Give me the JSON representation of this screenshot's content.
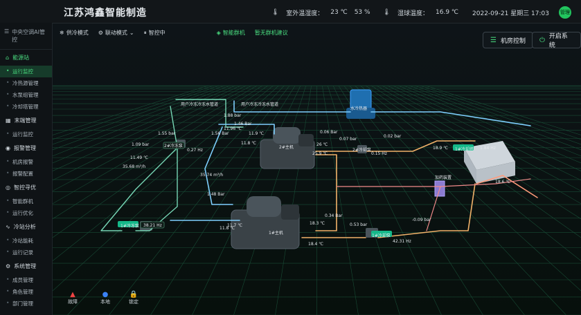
{
  "app": {
    "brand": "江苏鸿鑫智能制造"
  },
  "header": {
    "indoor_label": "室外温湿度：",
    "indoor_temp": "23 ℃",
    "indoor_humidity": "53 %",
    "outdoor_label": "湿球温度：",
    "outdoor_temp": "16.9 ℃",
    "datetime": "2022-09-21 星期三 17:03",
    "user_badge": "管理"
  },
  "sidebar": {
    "title": "中央空调AI管控",
    "groups": [
      {
        "label": "能源站",
        "items": [
          "运行监控",
          "冷热源管理",
          "水泵组管理",
          "冷却塔管理"
        ]
      },
      {
        "label": "末端管理",
        "items": [
          "运行监控"
        ]
      },
      {
        "label": "报警管理",
        "items": [
          "机房报警",
          "报警配置"
        ]
      },
      {
        "label": "智控寻优",
        "items": [
          "智能群机",
          "运行优化"
        ]
      },
      {
        "label": "冷站分析",
        "items": [
          "冷站能耗",
          "运行记录"
        ]
      },
      {
        "label": "系统管理",
        "items": [
          "成员管理",
          "角色管理",
          "部门管理"
        ]
      }
    ]
  },
  "toolbar": {
    "mode1": "供冷模式",
    "mode2": "联动模式",
    "mode3": "智控中",
    "smart": "智能群机",
    "suggest": "暂无群机建议"
  },
  "buttons": {
    "room_control": "机房控制",
    "start_system": "开启系统"
  },
  "diagram": {
    "user_supply": "用户冷冻冷冻水管道",
    "user_return": "用户冷冻冷冻水管道",
    "water_sep": "水冷热器",
    "chiller2": "2#主机",
    "chiller1": "1#主机",
    "pump2": "2#冷冻泵",
    "pump1": "1#冷冻泵",
    "cpump2": "2#冷却泵",
    "cpump1": "1#冷却泵",
    "tower": "1#冷却塔",
    "dosing": "加药装置",
    "v_1_88": "1.88 bar",
    "v_1_46": "1.46 Bar",
    "v_11_96": "11.96 ℃",
    "v_11_9": "11.9 ℃",
    "v_11_8a": "11.8 ℃",
    "v_1_55": "1.55 bar",
    "v_1_56": "1.56 Bar",
    "v_0_27": "0.27 Hz",
    "v_1_09": "1.09 bar",
    "v_11_49": "11.49 ℃",
    "v_35_68": "35.68 m³/h",
    "v_35_74": "35.74 m³/h",
    "v_0_06": "0.06 Bar",
    "v_0_07": "0.07 bar",
    "v_0_02": "0.02 bar",
    "v_26": "26 ℃",
    "v_25_9": "25.9 ℃",
    "v_0_15": "0.15 Hz",
    "v_18_9": "18.9 ℃",
    "v_1_84": "1.84 Hz",
    "v_18_6": "18.6 ℃",
    "v_1_48": "1.48 Bar",
    "v_11_7": "11.7 ℃",
    "v_11_8b": "11.8 ℃",
    "v_38_21": "38.21 Hz",
    "v_0_34": "0.34 Bar",
    "v_18_3": "18.3 ℃",
    "v_0_53": "0.53 bar",
    "v_m0_09": "-0.09 bar",
    "v_42_31": "42.31 Hz",
    "v_18_4": "18.4 ℃"
  },
  "footer": {
    "fault": "故障",
    "local": "本地",
    "lock": "锁定"
  },
  "colors": {
    "accent": "#4ade80",
    "supply": "#7fd0ff",
    "cooling": "#f2b26a",
    "grid": "#1f6b4a",
    "pipe_green": "#76d6b5"
  }
}
